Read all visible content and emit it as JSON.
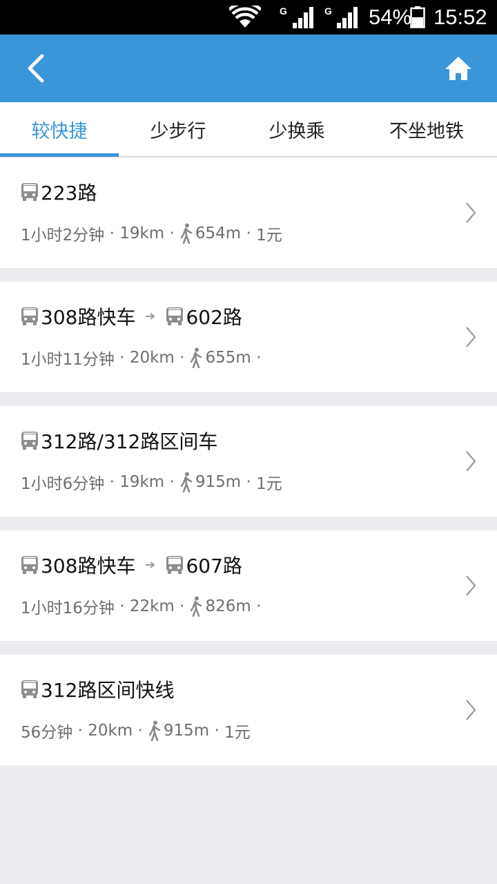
{
  "status_bar": {
    "network_type_1": "G",
    "network_type_2": "G",
    "battery": "54%",
    "time": "15:52",
    "icons": [
      "wifi-icon",
      "signal-icon",
      "signal-icon",
      "battery-icon"
    ]
  },
  "header": {
    "back_icon": "back-chevron-icon",
    "home_icon": "home-icon"
  },
  "tabs": [
    {
      "label": "较快捷",
      "active": true
    },
    {
      "label": "少步行",
      "active": false
    },
    {
      "label": "少换乘",
      "active": false
    },
    {
      "label": "不坐地铁",
      "active": false
    }
  ],
  "colors": {
    "accent": "#3a95d9",
    "background": "#ebebf0",
    "meta_text": "#6e6e6e"
  },
  "routes": [
    {
      "lines": [
        "223路"
      ],
      "duration": "1小时2分钟",
      "distance": "19km",
      "walk": "654m",
      "price": "1元"
    },
    {
      "lines": [
        "308路快车",
        "602路"
      ],
      "duration": "1小时11分钟",
      "distance": "20km",
      "walk": "655m",
      "price": ""
    },
    {
      "lines": [
        "312路/312路区间车"
      ],
      "duration": "1小时6分钟",
      "distance": "19km",
      "walk": "915m",
      "price": "1元"
    },
    {
      "lines": [
        "308路快车",
        "607路"
      ],
      "duration": "1小时16分钟",
      "distance": "22km",
      "walk": "826m",
      "price": ""
    },
    {
      "lines": [
        "312路区间快线"
      ],
      "duration": "56分钟",
      "distance": "20km",
      "walk": "915m",
      "price": "1元"
    }
  ]
}
